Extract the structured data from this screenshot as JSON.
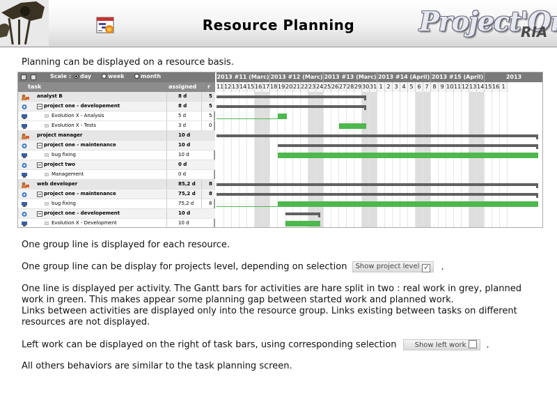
{
  "header": {
    "title": "Resource Planning",
    "brand": "Project'Or",
    "brand_sub": "RIA"
  },
  "intro": "Planning can be displayed on a resource basis.",
  "gantt": {
    "toolbar": {
      "scale_label": "Scale :",
      "options": [
        "day",
        "week",
        "month"
      ],
      "selected": "day"
    },
    "columns": {
      "task": "task",
      "assigned": "assigned",
      "r": "r"
    },
    "weeks": [
      "2013 #11 (Marc)",
      "2013 #12 (Marc)",
      "2013 #13 (Marc)",
      "2013 #14 (April)",
      "2013 #15 (April)",
      "2013"
    ],
    "days": [
      "11",
      "12",
      "13",
      "14",
      "15",
      "16",
      "17",
      "18",
      "19",
      "20",
      "21",
      "22",
      "23",
      "24",
      "25",
      "26",
      "27",
      "28",
      "29",
      "30",
      "31",
      "1",
      "2",
      "3",
      "4",
      "5",
      "6",
      "7",
      "8",
      "9",
      "10",
      "11",
      "12",
      "13",
      "14",
      "15",
      "16",
      "1"
    ],
    "rows": [
      {
        "kind": "resource",
        "name": "analyst B",
        "assigned": "8 d",
        "r": "5"
      },
      {
        "kind": "project",
        "name": "project one - developement",
        "assigned": "8 d",
        "r": "5"
      },
      {
        "kind": "activity",
        "name": "Evolution X - Analysis",
        "assigned": "5 d",
        "r": "5"
      },
      {
        "kind": "activity",
        "name": "Evolution X - Tests",
        "assigned": "3 d",
        "r": "0"
      },
      {
        "kind": "resource",
        "name": "project manager",
        "assigned": "10 d",
        "r": ""
      },
      {
        "kind": "project",
        "name": "project one - maintenance",
        "assigned": "10 d",
        "r": ""
      },
      {
        "kind": "activity",
        "name": "bug fixing",
        "assigned": "10 d",
        "r": ""
      },
      {
        "kind": "project",
        "name": "project two",
        "assigned": "0 d",
        "r": ""
      },
      {
        "kind": "activity",
        "name": "Management",
        "assigned": "0 d",
        "r": ""
      },
      {
        "kind": "resource",
        "name": "web developer",
        "assigned": "85,2 d",
        "r": "8"
      },
      {
        "kind": "project",
        "name": "project one - maintenance",
        "assigned": "75,2 d",
        "r": "8"
      },
      {
        "kind": "activity",
        "name": "bug fixing",
        "assigned": "75,2 d",
        "r": "8"
      },
      {
        "kind": "project",
        "name": "project one - developement",
        "assigned": "10 d",
        "r": ""
      },
      {
        "kind": "activity",
        "name": "Evolution X - Development",
        "assigned": "10 d",
        "r": ""
      }
    ],
    "bars": [
      {
        "row": 0,
        "type": "grey",
        "start": 0,
        "end": 19.5
      },
      {
        "row": 1,
        "type": "grey",
        "start": 0,
        "end": 19.5
      },
      {
        "row": 2,
        "type": "green",
        "start": 8,
        "end": 9.2
      },
      {
        "row": 2,
        "type": "thin",
        "start": 0,
        "end": 8
      },
      {
        "row": 3,
        "type": "green",
        "start": 16,
        "end": 19.5
      },
      {
        "row": 4,
        "type": "grey",
        "start": 0,
        "end": 42
      },
      {
        "row": 5,
        "type": "grey",
        "start": 8,
        "end": 42
      },
      {
        "row": 6,
        "type": "green",
        "start": 8,
        "end": 42
      },
      {
        "row": 9,
        "type": "grey",
        "start": 0,
        "end": 42
      },
      {
        "row": 10,
        "type": "grey",
        "start": 0,
        "end": 42
      },
      {
        "row": 11,
        "type": "green",
        "start": 8,
        "end": 42
      },
      {
        "row": 11,
        "type": "thin",
        "start": 0,
        "end": 8
      },
      {
        "row": 12,
        "type": "grey",
        "start": 9,
        "end": 13.5
      },
      {
        "row": 13,
        "type": "green",
        "start": 9,
        "end": 13.5
      }
    ]
  },
  "paragraphs": {
    "p1": "One group line is displayed for each resource.",
    "p2": "One group line can be display for projects level, depending on selection",
    "p2_control": "Show project level",
    "p2_check": "✓",
    "p2_end": ".",
    "p3a": "One line is displayed per activity. The Gantt bars for activities are hare split in two : real work in grey, planned work in green. This makes appear some planning gap between started work and planned work.",
    "p3b": "Links between activities are displayed only into the resource group. Links existing between tasks on different resources are not displayed.",
    "p4": "Left work can be displayed on the right of task bars, using corresponding selection",
    "p4_control": "Show left work",
    "p4_end": ".",
    "p5": "All others behaviors are similar to the task planning screen."
  },
  "colors": {
    "real_work": "#606060",
    "planned_work": "#4db84d",
    "header_bar": "#7a7a7a"
  }
}
